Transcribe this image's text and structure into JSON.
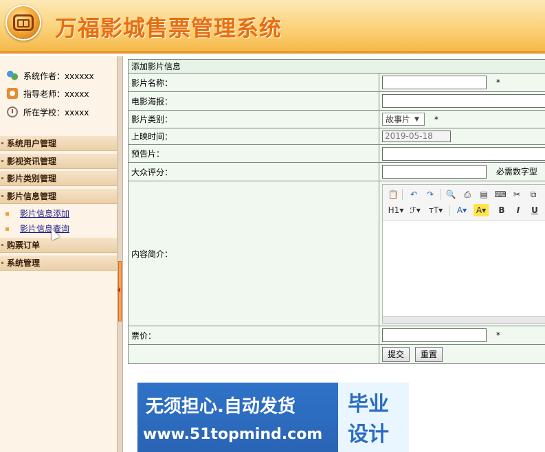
{
  "header": {
    "title": "万福影城售票管理系统"
  },
  "sidebar": {
    "info": [
      {
        "label": "系统作者：xxxxxx",
        "icon": "users-icon"
      },
      {
        "label": "指导老师：xxxxx",
        "icon": "teacher-icon"
      },
      {
        "label": "所在学校：xxxxx",
        "icon": "school-icon"
      }
    ],
    "menu": [
      {
        "label": "系统用户管理"
      },
      {
        "label": "影视资讯管理"
      },
      {
        "label": "影片类别管理"
      },
      {
        "label": "影片信息管理"
      },
      {
        "label": "购票订单"
      },
      {
        "label": "系统管理"
      }
    ],
    "submenu": [
      {
        "label": "影片信息添加"
      },
      {
        "label": "影片信息查询"
      }
    ]
  },
  "form": {
    "section_title": "添加影片信息",
    "rows": {
      "name": {
        "label": "影片名称：",
        "value": "",
        "required": "*"
      },
      "poster": {
        "label": "电影海报：",
        "value": ""
      },
      "category": {
        "label": "影片类别：",
        "selected": "故事片",
        "required": "*"
      },
      "release": {
        "label": "上映时间：",
        "value": "2019-05-18"
      },
      "trailer": {
        "label": "预告片：",
        "value": ""
      },
      "rating": {
        "label": "大众评分：",
        "value": "",
        "hint": "必需数字型"
      },
      "intro": {
        "label": "内容简介："
      },
      "price": {
        "label": "票价：",
        "value": "",
        "required": "*"
      }
    },
    "editor_toolbar": {
      "heading": "H1",
      "font": "ℱ",
      "size": "тT",
      "font_color": "A",
      "highlight": "A",
      "bold": "B",
      "italic": "I",
      "underline": "U"
    },
    "buttons": {
      "submit": "提交",
      "reset": "重置"
    }
  },
  "banner": {
    "line1": "无须担心.自动发货",
    "line2": "www.51topmind.com",
    "box_line1": "毕业",
    "box_line2": "设计"
  },
  "colors": {
    "title": "#e66f12",
    "accent": "#f6b94a",
    "sidebar_bg": "#fdf3e6",
    "form_bg": "#f0f8f0"
  }
}
